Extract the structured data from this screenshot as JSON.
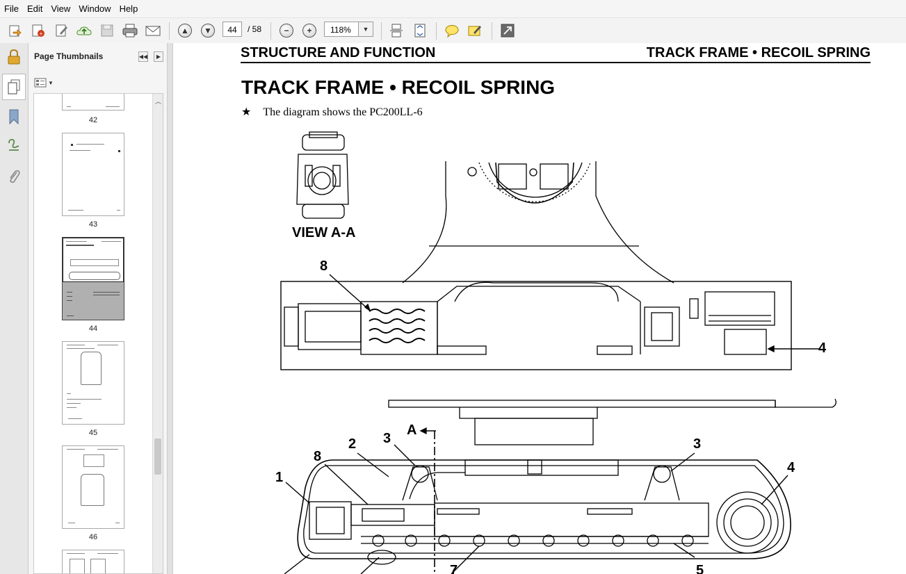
{
  "menu": {
    "items": [
      "File",
      "Edit",
      "View",
      "Window",
      "Help"
    ]
  },
  "toolbar": {
    "current_page": "44",
    "total_pages": "/ 58",
    "zoom": "118%"
  },
  "panel": {
    "title": "Page Thumbnails",
    "thumbnails": [
      {
        "page": "42"
      },
      {
        "page": "43"
      },
      {
        "page": "44"
      },
      {
        "page": "45"
      },
      {
        "page": "46"
      }
    ]
  },
  "document": {
    "header_left": "STRUCTURE AND FUNCTION",
    "header_right": "TRACK FRAME • RECOIL SPRING",
    "title": "TRACK FRAME • RECOIL SPRING",
    "note_star": "★",
    "note": "The diagram shows the PC200LL-6",
    "view_label": "VIEW A-A",
    "callouts": {
      "c1": "1",
      "c2": "2",
      "c3a": "3",
      "c3b": "3",
      "c4a": "4",
      "c4b": "4",
      "c8a": "8",
      "c8b": "8",
      "cA": "A",
      "c7": "7",
      "c5": "5"
    }
  }
}
